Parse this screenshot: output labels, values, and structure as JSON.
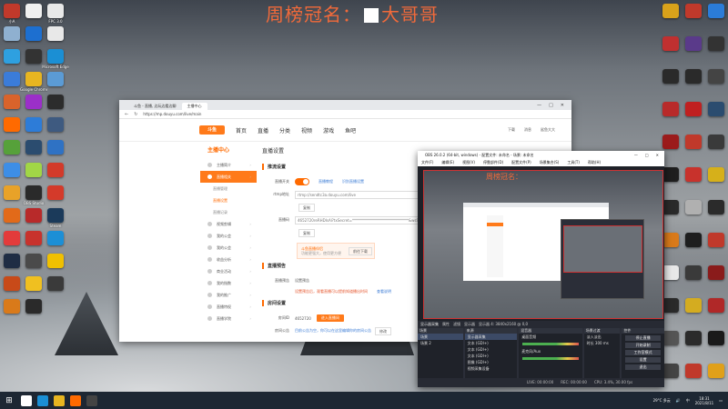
{
  "overlay": {
    "title": "周榜冠名：",
    "title2": "大哥哥"
  },
  "desktop_left_icons": [
    {
      "label": "小A",
      "color": "#c0392b"
    },
    {
      "label": "",
      "color": "#f0f0f0"
    },
    {
      "label": "FPC 3.0",
      "color": "#e8e8e8"
    },
    {
      "label": "",
      "color": "#8fb0d0"
    },
    {
      "label": "",
      "color": "#1d6fd0"
    },
    {
      "label": "",
      "color": "#e8e8e8"
    },
    {
      "label": "",
      "color": "#2ea0e0"
    },
    {
      "label": "",
      "color": "#333"
    },
    {
      "label": "Microsoft Edge",
      "color": "#1b8fd4"
    },
    {
      "label": "",
      "color": "#3b7cd9"
    },
    {
      "label": "Google Chrome",
      "color": "#e8b520"
    },
    {
      "label": "",
      "color": "#5b9bd5"
    },
    {
      "label": "",
      "color": "#d9632b"
    },
    {
      "label": "",
      "color": "#9b2fc9"
    },
    {
      "label": "",
      "color": "#2c2c2c"
    },
    {
      "label": "",
      "color": "#ff6a00"
    },
    {
      "label": "",
      "color": "#2d7cd8"
    },
    {
      "label": "",
      "color": "#3e5a80"
    },
    {
      "label": "",
      "color": "#56a13a"
    },
    {
      "label": "",
      "color": "#2b4c6f"
    },
    {
      "label": "",
      "color": "#2f72c4"
    },
    {
      "label": "",
      "color": "#3d8ee6"
    },
    {
      "label": "",
      "color": "#a1d646"
    },
    {
      "label": "",
      "color": "#d33a2a"
    },
    {
      "label": "",
      "color": "#e8a228"
    },
    {
      "label": "OBS Studio",
      "color": "#2a2a2a"
    },
    {
      "label": "",
      "color": "#d43a2a"
    },
    {
      "label": "",
      "color": "#e26a19"
    },
    {
      "label": "",
      "color": "#b82a2a"
    },
    {
      "label": "Steam",
      "color": "#1b3a5a"
    },
    {
      "label": "",
      "color": "#e33b3b"
    },
    {
      "label": "",
      "color": "#c8322c"
    },
    {
      "label": "",
      "color": "#1c8fd6"
    },
    {
      "label": "",
      "color": "#1f2d44"
    },
    {
      "label": "",
      "color": "#4a4a4a"
    },
    {
      "label": "",
      "color": "#f0c000"
    },
    {
      "label": "",
      "color": "#c84a19"
    },
    {
      "label": "",
      "color": "#f0c020"
    },
    {
      "label": "",
      "color": "#3a3a3a"
    },
    {
      "label": "",
      "color": "#d97a1a"
    },
    {
      "label": "",
      "color": "#2a2a2a"
    }
  ],
  "desktop_right_icons": [
    {
      "label": "",
      "color": "#d9a21a"
    },
    {
      "label": "",
      "color": "#c0392b"
    },
    {
      "label": "",
      "color": "#2b7cd8"
    },
    {
      "label": "",
      "color": "#c03030"
    },
    {
      "label": "",
      "color": "#5a3a8a"
    },
    {
      "label": "",
      "color": "#333"
    },
    {
      "label": "",
      "color": "#2a2a2a"
    },
    {
      "label": "",
      "color": "#2a2a2a"
    },
    {
      "label": "",
      "color": "#444"
    },
    {
      "label": "",
      "color": "#b82a2a"
    },
    {
      "label": "",
      "color": "#c02020"
    },
    {
      "label": "",
      "color": "#2b4c6f"
    },
    {
      "label": "",
      "color": "#9b1b1b"
    },
    {
      "label": "",
      "color": "#c0392b"
    },
    {
      "label": "",
      "color": "#3a3a3a"
    },
    {
      "label": "",
      "color": "#1e1e1e"
    },
    {
      "label": "",
      "color": "#c8322c"
    },
    {
      "label": "",
      "color": "#d6b01a"
    },
    {
      "label": "",
      "color": "#2a2a2a"
    },
    {
      "label": "",
      "color": "#b0b0b0"
    },
    {
      "label": "",
      "color": "#2b2b2b"
    },
    {
      "label": "",
      "color": "#d97a1a"
    },
    {
      "label": "",
      "color": "#1e1e1e"
    },
    {
      "label": "",
      "color": "#c0392b"
    },
    {
      "label": "",
      "color": "#e8e8e8"
    },
    {
      "label": "",
      "color": "#3a3a3a"
    },
    {
      "label": "",
      "color": "#8a1b1b"
    },
    {
      "label": "",
      "color": "#2a2a2a"
    },
    {
      "label": "",
      "color": "#d4ac20"
    },
    {
      "label": "",
      "color": "#b02828"
    },
    {
      "label": "",
      "color": "#555"
    },
    {
      "label": "",
      "color": "#2b2b2b"
    },
    {
      "label": "",
      "color": "#1a1a1a"
    },
    {
      "label": "",
      "color": "#444"
    },
    {
      "label": "",
      "color": "#c0392b"
    },
    {
      "label": "",
      "color": "#e0a01a"
    }
  ],
  "browser": {
    "tabs": [
      "斗鱼 - 直播, 边玩边看边聊",
      "主播中心"
    ],
    "url": "https://mp.douyu.com/live/main",
    "logo": "斗鱼",
    "nav": [
      "首页",
      "直播",
      "分类",
      "视频",
      "游戏",
      "鱼吧"
    ],
    "header_right": [
      "下载",
      "消息",
      "鲨鱼大大"
    ],
    "sidebar": {
      "head": "主播中心",
      "items": [
        {
          "label": "主播简介",
          "type": "item"
        },
        {
          "label": "直播相关",
          "type": "active"
        },
        {
          "label": "直播管理",
          "type": "sub"
        },
        {
          "label": "直播设置",
          "type": "sub-sel"
        },
        {
          "label": "直播记录",
          "type": "sub"
        },
        {
          "label": "视频剪辑",
          "type": "item"
        },
        {
          "label": "我的公会",
          "type": "item"
        },
        {
          "label": "我的公会",
          "type": "item"
        },
        {
          "label": "收益分析",
          "type": "item"
        },
        {
          "label": "商业活动",
          "type": "item"
        },
        {
          "label": "我的指数",
          "type": "item"
        },
        {
          "label": "我的推广",
          "type": "item"
        },
        {
          "label": "直播特权",
          "type": "item"
        },
        {
          "label": "直播学院",
          "type": "item"
        }
      ]
    },
    "content": {
      "title": "直播设置",
      "sec1": "推流设置",
      "live_switch_label": "直播开关",
      "link1": "直播教程",
      "link2": "识别直播设置",
      "rtmp_label": "rtmp地址",
      "rtmp_value": "rtmp://sendtc3a.douyu.com/live",
      "copy": "复制",
      "key_label": "直播码",
      "key_value": "4652720reRHDIsAl?txSecret=*******************************&wsSecret=",
      "copy2": "复制",
      "banner_text": "斗鱼直播伴侣",
      "banner_sub": "功能更强大，使用更方便",
      "banner_btn": "前往下载",
      "sec2": "直播预告",
      "preview_label": "直播预告",
      "preview_value": "设置预告",
      "preview_warn": "设置预告后，观看直播可以提前知道播出时间",
      "preview_link": "查看说明",
      "sec3": "房间设置",
      "room_label": "房间ID",
      "room_value": "4652720",
      "room_btn": "进入直播间",
      "notice_label": "房间公告",
      "notice_value": "目前公告为空，你可以在这里编辑你的房间公告",
      "notice_btn": "修改"
    }
  },
  "obs": {
    "title": "OBS 26.0.2 (64-bit, windows) - 配置文件: 未命名 - 场景: 未命名",
    "menu": [
      "文件(F)",
      "编辑(E)",
      "视图(V)",
      "停靠部件(D)",
      "配置文件(P)",
      "场景集合(S)",
      "工具(T)",
      "帮助(H)"
    ],
    "preview_title": "周榜冠名：",
    "status": [
      "显示器采集",
      "属性",
      "滤镜",
      "显示器",
      "显示器 4: 3840x2160 @ 0,0"
    ],
    "panels": {
      "scenes": {
        "title": "场景",
        "items": [
          "场景",
          "场景 2"
        ]
      },
      "sources": {
        "title": "来源",
        "items": [
          "显示器采集",
          "文本 (GDI+)",
          "文本 (GDI+)",
          "文本 (GDI+)",
          "图像 (GDI+)",
          "视频采集设备"
        ]
      },
      "mixer": {
        "title": "混音器",
        "items": [
          "桌面音频",
          "麦克风/Aux"
        ]
      },
      "transitions": {
        "title": "场景过渡",
        "items": [
          "淡入淡出",
          "时长 300 ms"
        ]
      },
      "controls": {
        "title": "控件",
        "items": [
          "停止直播",
          "开始录制",
          "工作室模式",
          "设置",
          "退出"
        ]
      }
    },
    "footer": [
      "LIVE: 00:00:00",
      "REC: 00:00:00",
      "CPU: 3.4%, 30.00 fps"
    ]
  },
  "taskbar": {
    "start": "⊞",
    "apps": [
      {
        "name": "search-icon",
        "color": "#ffffff"
      },
      {
        "name": "edge-icon",
        "color": "#1b8fd4"
      },
      {
        "name": "chrome-icon",
        "color": "#e8b520"
      },
      {
        "name": "douyu-icon",
        "color": "#ff6a00"
      },
      {
        "name": "obs-icon",
        "color": "#444444"
      }
    ],
    "weather": "29°C 多云",
    "lang": "中",
    "time": "18:31",
    "date": "2021/8/11"
  }
}
